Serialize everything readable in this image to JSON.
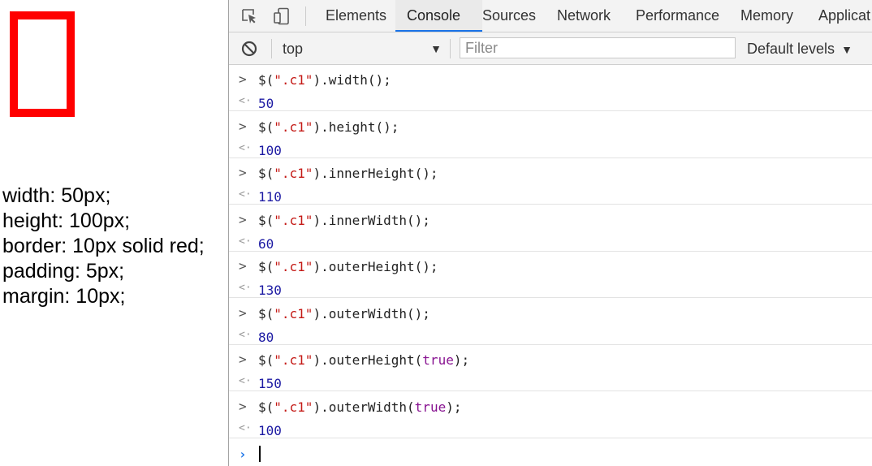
{
  "page": {
    "css_lines": [
      "width: 50px;",
      "height: 100px;",
      "border: 10px solid red;",
      "padding: 5px;",
      "margin: 10px;"
    ]
  },
  "devtools": {
    "tabs": [
      {
        "label": "Elements",
        "active": false
      },
      {
        "label": "Console",
        "active": true
      },
      {
        "label": "Sources",
        "active": false
      },
      {
        "label": "Network",
        "active": false
      },
      {
        "label": "Performance",
        "active": false
      },
      {
        "label": "Memory",
        "active": false
      },
      {
        "label": "Applicat",
        "active": false
      }
    ],
    "filterbar": {
      "context": "top",
      "filter_placeholder": "Filter",
      "levels": "Default levels"
    },
    "console": {
      "entries": [
        {
          "prefix": "$(",
          "selector": "\".c1\"",
          "method": ").width(",
          "arg": "",
          "suffix": ");",
          "result": "50"
        },
        {
          "prefix": "$(",
          "selector": "\".c1\"",
          "method": ").height(",
          "arg": "",
          "suffix": ");",
          "result": "100"
        },
        {
          "prefix": "$(",
          "selector": "\".c1\"",
          "method": ").innerHeight(",
          "arg": "",
          "suffix": ");",
          "result": "110"
        },
        {
          "prefix": "$(",
          "selector": "\".c1\"",
          "method": ").innerWidth(",
          "arg": "",
          "suffix": ");",
          "result": "60"
        },
        {
          "prefix": "$(",
          "selector": "\".c1\"",
          "method": ").outerHeight(",
          "arg": "",
          "suffix": ");",
          "result": "130"
        },
        {
          "prefix": "$(",
          "selector": "\".c1\"",
          "method": ").outerWidth(",
          "arg": "",
          "suffix": ");",
          "result": "80"
        },
        {
          "prefix": "$(",
          "selector": "\".c1\"",
          "method": ").outerHeight(",
          "arg": "true",
          "suffix": ");",
          "result": "150"
        },
        {
          "prefix": "$(",
          "selector": "\".c1\"",
          "method": ").outerWidth(",
          "arg": "true",
          "suffix": ");",
          "result": "100"
        }
      ]
    }
  },
  "colors": {
    "box_border": "#ff0000",
    "active_tab_underline": "#1a73e8",
    "result_number": "#1c1aa3",
    "string_literal": "#c41a16",
    "keyword": "#881391"
  },
  "icons": {
    "inspect": "inspect-element-icon",
    "device": "device-toolbar-icon",
    "clear": "clear-console-icon",
    "input_prompt": "chevron-right-icon",
    "output": "return-arrow-icon"
  }
}
